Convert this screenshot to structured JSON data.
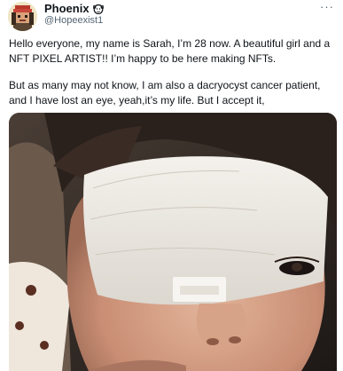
{
  "tweet": {
    "author": {
      "display_name": "Phoenix",
      "handle": "@Hopeexist1",
      "badge_icon": "monkey-badge-icon",
      "avatar_icon": "pixel-art-avatar"
    },
    "more_label": "···",
    "paragraphs": [
      "Hello everyone, my name is Sarah, I’m 28 now. A beautiful girl and a NFT PIXEL ARTIST!! I’m happy to be here making NFTs.",
      "But as many may not know, I am also a dacryocyst cancer patient, and I have lost an eye, yeah,it’s my life. But I accept it,"
    ],
    "media": {
      "type": "photo",
      "subject": "face-with-eye-bandage"
    }
  },
  "colors": {
    "text_primary": "#0f1419",
    "text_secondary": "#536471",
    "background": "#ffffff"
  }
}
